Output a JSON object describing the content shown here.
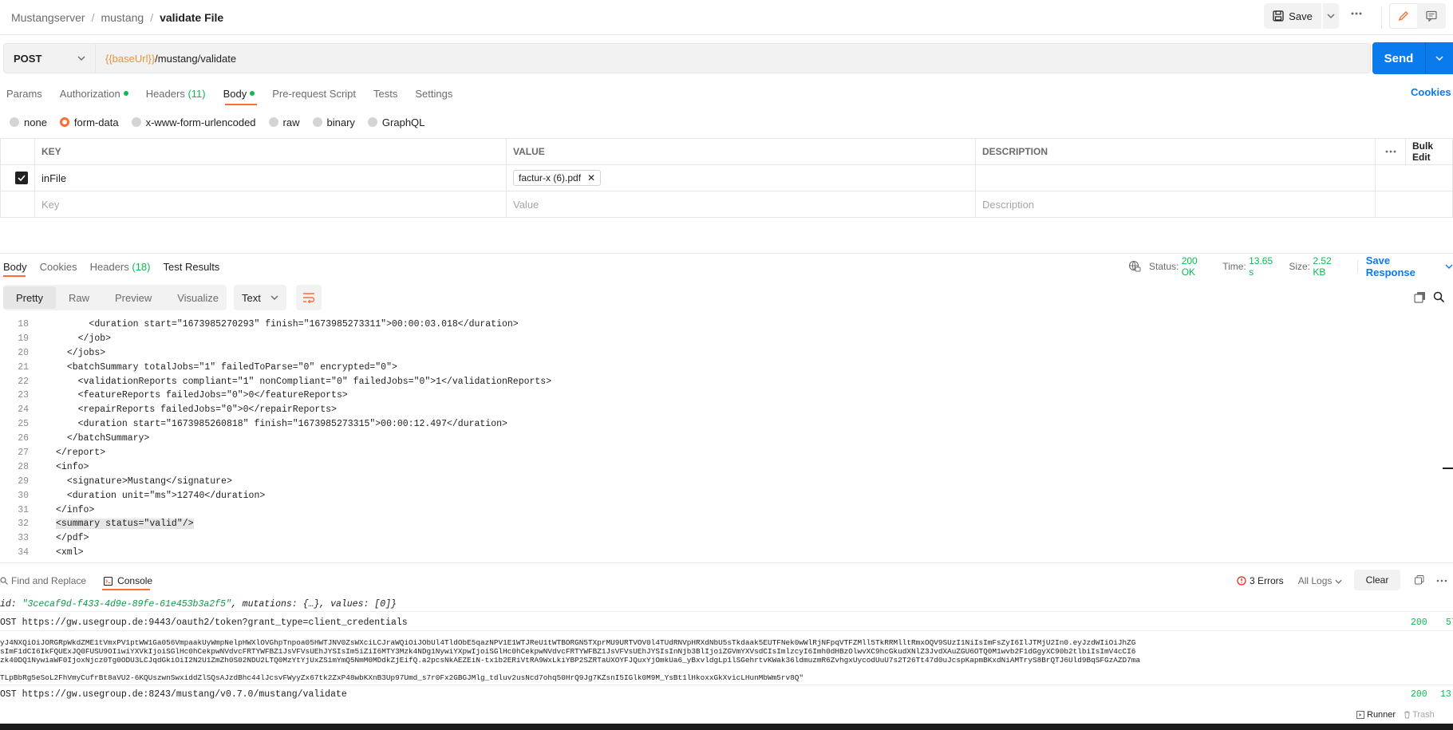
{
  "breadcrumb": {
    "workspace": "Mustangserver",
    "collection": "mustang",
    "request": "validate File"
  },
  "header_actions": {
    "save_label": "Save"
  },
  "request": {
    "method": "POST",
    "url_var": "{{baseUrl}}",
    "url_path": "/mustang/validate",
    "send_label": "Send"
  },
  "request_tabs": {
    "params": "Params",
    "authorization": "Authorization",
    "headers": "Headers",
    "headers_count": "(11)",
    "body": "Body",
    "prerequest": "Pre-request Script",
    "tests": "Tests",
    "settings": "Settings",
    "cookies": "Cookies"
  },
  "body_types": [
    "none",
    "form-data",
    "x-www-form-urlencoded",
    "raw",
    "binary",
    "GraphQL"
  ],
  "kv_table": {
    "col_key": "KEY",
    "col_value": "VALUE",
    "col_description": "DESCRIPTION",
    "bulk_edit": "Bulk Edit",
    "row_key": "inFile",
    "row_file": "factur-x (6).pdf",
    "ph_key": "Key",
    "ph_value": "Value",
    "ph_description": "Description"
  },
  "response_tabs": {
    "body": "Body",
    "cookies": "Cookies",
    "headers": "Headers",
    "headers_count": "(18)",
    "test_results": "Test Results"
  },
  "response_status": {
    "status_label": "Status:",
    "status_value": "200 OK",
    "time_label": "Time:",
    "time_value": "13.65 s",
    "size_label": "Size:",
    "size_value": "2.52 KB",
    "save_response": "Save Response"
  },
  "view_modes": {
    "pretty": "Pretty",
    "raw": "Raw",
    "preview": "Preview",
    "visualize": "Visualize",
    "format": "Text"
  },
  "code_lines": [
    {
      "n": "18",
      "indent": "      ",
      "text": "<duration start=\"1673985270293\" finish=\"1673985273311\">00:00:03.018</duration>"
    },
    {
      "n": "19",
      "indent": "    ",
      "text": "</job>"
    },
    {
      "n": "20",
      "indent": "  ",
      "text": "</jobs>"
    },
    {
      "n": "21",
      "indent": "  ",
      "text": "<batchSummary totalJobs=\"1\" failedToParse=\"0\" encrypted=\"0\">"
    },
    {
      "n": "22",
      "indent": "    ",
      "text": "<validationReports compliant=\"1\" nonCompliant=\"0\" failedJobs=\"0\">1</validationReports>"
    },
    {
      "n": "23",
      "indent": "    ",
      "text": "<featureReports failedJobs=\"0\">0</featureReports>"
    },
    {
      "n": "24",
      "indent": "    ",
      "text": "<repairReports failedJobs=\"0\">0</repairReports>"
    },
    {
      "n": "25",
      "indent": "    ",
      "text": "<duration start=\"1673985260818\" finish=\"1673985273315\">00:00:12.497</duration>"
    },
    {
      "n": "26",
      "indent": "  ",
      "text": "</batchSummary>"
    },
    {
      "n": "27",
      "indent": "",
      "text": "</report>"
    },
    {
      "n": "28",
      "indent": "",
      "text": "<info>"
    },
    {
      "n": "29",
      "indent": "  ",
      "text": "<signature>Mustang</signature>"
    },
    {
      "n": "30",
      "indent": "  ",
      "text": "<duration unit=\"ms\">12740</duration>"
    },
    {
      "n": "31",
      "indent": "",
      "text": "</info>"
    },
    {
      "n": "32",
      "indent": "",
      "text": "<summary status=\"valid\"/>"
    },
    {
      "n": "33",
      "indent": "",
      "text": "</pdf>"
    },
    {
      "n": "34",
      "indent": "",
      "text": "<xml>"
    }
  ],
  "console": {
    "find_replace": "Find and Replace",
    "console_label": "Console",
    "errors": "3 Errors",
    "all_logs": "All Logs",
    "clear": "Clear",
    "line_id_prefix": "id: ",
    "line_id_value": "\"3cecaf9d-f433-4d9e-89fe-61e453b3a2f5\"",
    "line_id_rest": ", mutations: {…}, values: [0]}",
    "req1": "OST https://gw.usegroup.de:9443/oauth2/token?grant_type=client_credentials",
    "req1_status": "200",
    "req1_time": "57",
    "token1": "yJ4NXQiOiJORGRpWkdZME1tVmxPV1ptWW1Ga056VmpaakUyWmpNelpHWXlOVGhpTnpoa05HWTJNV0ZsWXciLCJraWQiOiJObUl4TldObE5qazNPV1E1WTJReU1tWTBORGN5TXprMU9URTVOV0l4TUdRNVpHRXdNbU5sTkdaak5EUTFNek0wWlRjNFpqVTFZMll5TkRRMlltRmxOQV9SUzI1NiIsImFsZyI6IlJTMjU2In0.eyJzdWIiOiJhZG",
    "token2": "sImF1dCI6IkFQUExJQ0FUSU9OIiwiYXVkIjoiSGlHc0hCekpwNVdvcFRTYWFBZ1JsVFVsUEhJYSIsIm5iZiI6MTY3Mzk4NDg1NywiYXpwIjoiSGlHc0hCekpwNVdvcFRTYWFBZ1JsVFVsUEhJYSIsInNjb3BlIjoiZGVmYXVsdCIsImlzcyI6Imh0dHBzOlwvXC9hcGkudXNlZ3JvdXAuZGU6OTQ0M1wvb2F1dGgyXC90b2tlbiIsImV4cCI6",
    "token3": "zk40DQ1NywiaWF0IjoxNjcz0Tg0ODU3LCJqdGkiOiI2N2U1ZmZh0S02NDU2LTQ0MzYtYjUxZS1mYmQ5NmM0MDdkZjEifQ.a2pcsNkAEZEiN-tx1b2ERiVtRA9WxLkiYBP2SZRTaUXOYFJQuxYjOmkUa6_yBxvldgLp1lSGehrtvKWak36ldmuzmR6ZvhgxUycodUuU7s2T26Tt47d0uJcspKapmBKxdNiAMTryS8BrQTJ6Uld9BqSFGzAZD7ma",
    "token4": "TLpBbRg5eSoL2FhVmyCufrBt8aVU2-6KQUszwnSwxiddZlSQsAJzdBhc44lJcsvFWyyZx67tk2ZxP48wbKXnB3Up97Umd_s7r0Fx2GBGJMlg_tdluv2usNcd7ohq50HrQ9Jg7KZsnI5IGlk0M9M_YsBt1lHkoxxGkXvicLHunMbWm5rv8Q\"",
    "req2": "OST https://gw.usegroup.de:8243/mustang/v0.7.0/mustang/validate",
    "req2_status": "200",
    "req2_time": "13",
    "runner": "Runner",
    "trash": "Trash"
  }
}
